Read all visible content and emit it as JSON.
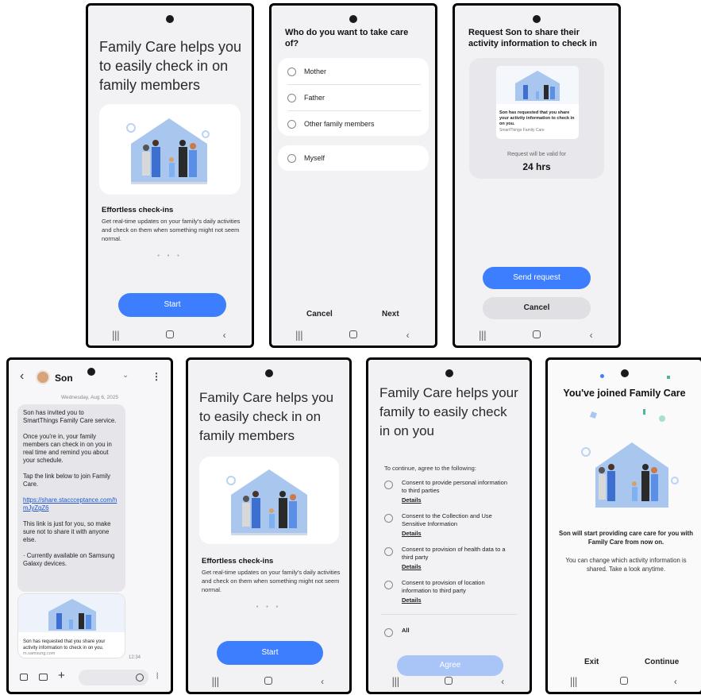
{
  "intro": {
    "title": "Family Care helps you to easily check in on family members",
    "feature_title": "Effortless check-ins",
    "feature_desc": "Get real-time updates on your family's daily activities and check on them when something might not seem normal.",
    "start_label": "Start",
    "page_dots": "● ● ●"
  },
  "choose": {
    "title": "Who do you want to take care of?",
    "options": [
      "Mother",
      "Father",
      "Other family members"
    ],
    "self_option": "Myself",
    "cancel_label": "Cancel",
    "next_label": "Next"
  },
  "request": {
    "title": "Request Son to share their activity information to check in",
    "preview_text": "Son has requested that you share your activity information to check in on you.",
    "preview_source": "SmartThings Family Care",
    "valid_label": "Request will be valid for",
    "valid_value": "24 hrs",
    "send_label": "Send request",
    "cancel_label": "Cancel"
  },
  "chat": {
    "contact_name": "Son",
    "date": "Wednesday, Aug 6, 2025",
    "message_p1": "Son has invited you to SmartThings Family Care service.",
    "message_p2": "Once you're in, your family members can check in on you in real time and remind you about your schedule.",
    "message_p3": "Tap the link below to join Family Care.",
    "message_link": "https://share.staccceptance.com/hmJyZgZ6",
    "message_p4": "This link is just for you, so make sure not to share it with anyone else.",
    "message_p5": "· Currently available on Samsung Galaxy devices.",
    "preview_text": "Son has requested that you share your activity information to check in on you.",
    "preview_source": "m.samsung.com",
    "time": "12:34"
  },
  "consent": {
    "title": "Family Care helps your family to easily check in on you",
    "intro": "To continue, agree to the following:",
    "items": [
      {
        "text": "Consent to provide personal information to third parties",
        "details": "Details"
      },
      {
        "text": "Consent to the Collection and Use Sensitive Information",
        "details": "Details"
      },
      {
        "text": "Consent to provision of health data to a third party",
        "details": "Details"
      },
      {
        "text": "Consent to provision of location information to third party",
        "details": "Details"
      }
    ],
    "all_label": "All",
    "agree_label": "Agree"
  },
  "joined": {
    "title": "You've joined Family Care",
    "message": "Son will start providing care care for you with Family Care from now on.",
    "sub": "You can change which activity information is shared. Take a look anytime.",
    "exit_label": "Exit",
    "continue_label": "Continue"
  },
  "colors": {
    "accent": "#3d7eff",
    "illustration": "#a9c6ef"
  }
}
